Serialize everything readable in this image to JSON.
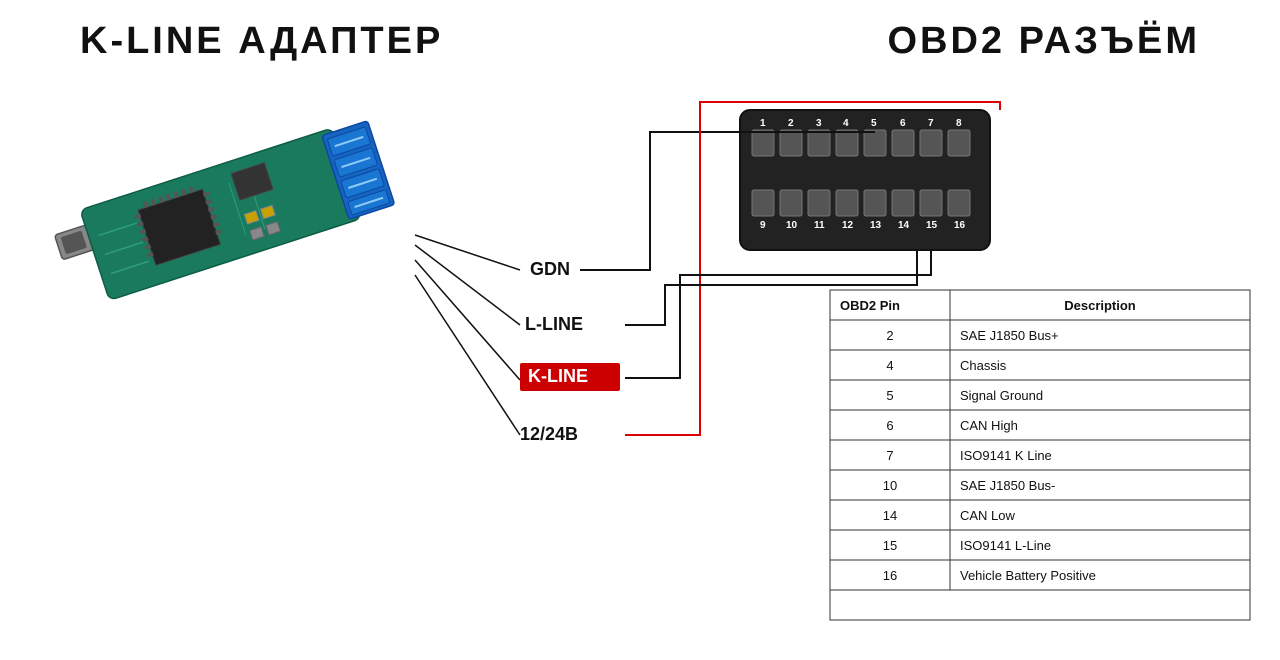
{
  "titles": {
    "left": "K-LINE АДАПТЕР",
    "right": "OBD2 РАЗЪЁМ"
  },
  "adapter_labels": {
    "gdn": "GDN",
    "lline": "L-LINE",
    "kline": "K-LINE",
    "power": "12/24В"
  },
  "obd2_connector": {
    "row1_pins": [
      "1",
      "2",
      "3",
      "4",
      "5",
      "6",
      "7",
      "8"
    ],
    "row2_pins": [
      "9",
      "10",
      "11",
      "12",
      "13",
      "14",
      "15",
      "16"
    ]
  },
  "table": {
    "header_pin": "OBD2 Pin",
    "header_desc": "Description",
    "rows": [
      {
        "pin": "2",
        "desc": "SAE J1850 Bus+"
      },
      {
        "pin": "4",
        "desc": "Chassis"
      },
      {
        "pin": "5",
        "desc": "Signal Ground"
      },
      {
        "pin": "6",
        "desc": "CAN High"
      },
      {
        "pin": "7",
        "desc": "ISO9141 K Line"
      },
      {
        "pin": "10",
        "desc": "SAE J1850 Bus-"
      },
      {
        "pin": "14",
        "desc": "CAN Low"
      },
      {
        "pin": "15",
        "desc": "ISO9141 L-Line"
      },
      {
        "pin": "16",
        "desc": "Vehicle Battery Positive"
      }
    ]
  },
  "colors": {
    "background": "#ffffff",
    "pcb_green": "#1a7a5e",
    "terminal_blue": "#1565C0",
    "kline_red": "#cc0000",
    "wire_black": "#111111",
    "wire_red": "#dd0000",
    "connector_dark": "#222222"
  }
}
